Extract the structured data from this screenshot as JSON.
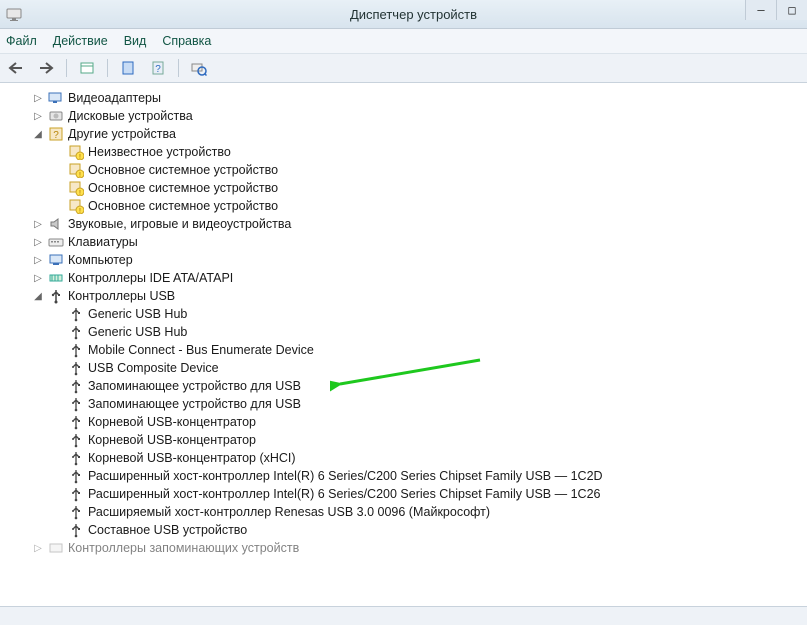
{
  "window": {
    "title": "Диспетчер устройств",
    "minimize": "—",
    "maximize": "□"
  },
  "menu": {
    "file": "Файл",
    "action": "Действие",
    "view": "Вид",
    "help": "Справка"
  },
  "tree": {
    "video_adapters": "Видеоадаптеры",
    "disk_devices": "Дисковые устройства",
    "other_devices": "Другие устройства",
    "other_children": [
      "Неизвестное устройство",
      "Основное системное устройство",
      "Основное системное устройство",
      "Основное системное устройство"
    ],
    "sound": "Звуковые, игровые и видеоустройства",
    "keyboards": "Клавиатуры",
    "computer": "Компьютер",
    "ide": "Контроллеры IDE ATA/ATAPI",
    "usb": "Контроллеры USB",
    "usb_children": [
      "Generic USB Hub",
      "Generic USB Hub",
      "Mobile Connect - Bus Enumerate Device",
      "USB Composite Device",
      "Запоминающее устройство для USB",
      "Запоминающее устройство для USB",
      "Корневой USB-концентратор",
      "Корневой USB-концентратор",
      "Корневой USB-концентратор (xHCI)",
      "Расширенный хост-контроллер Intel(R) 6 Series/C200 Series Chipset Family USB — 1C2D",
      "Расширенный хост-контроллер Intel(R) 6 Series/C200 Series Chipset Family USB — 1C26",
      "Расширяемый хост-контроллер Renesas USB 3.0 0096 (Майкрософт)",
      "Составное USB устройство"
    ],
    "storage_controllers": "Контроллеры запоминающих устройств"
  }
}
